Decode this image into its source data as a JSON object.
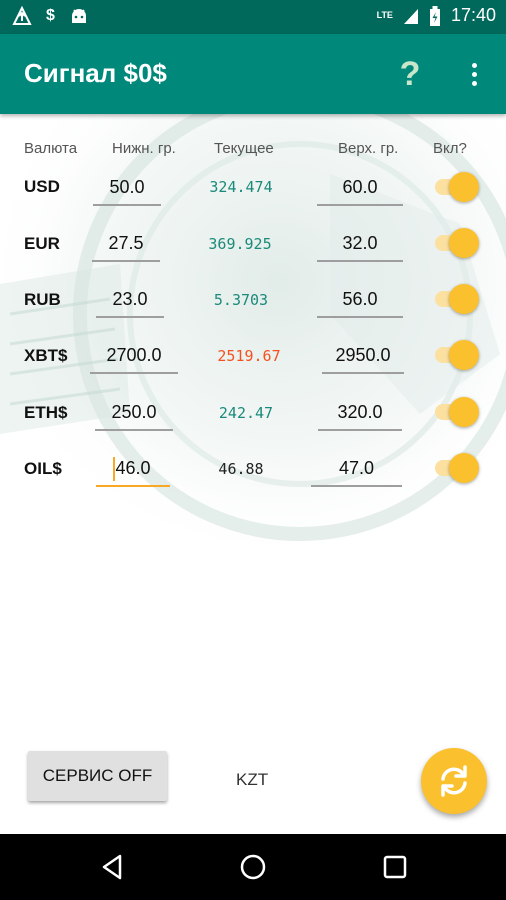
{
  "status_bar": {
    "dollar_icon_text": "$",
    "network_label": "LTE",
    "time": "17:40"
  },
  "app_bar": {
    "title": "Сигнал $0$",
    "help_label": "?"
  },
  "table": {
    "headers": [
      "Валюта",
      "Нижн. гр.",
      "Текущее",
      "Верх. гр.",
      "Вкл?"
    ],
    "rows": [
      {
        "currency": "USD",
        "lower": "50.0",
        "current": "324.474",
        "current_color": "#1b8a7a",
        "upper": "60.0",
        "enabled": true
      },
      {
        "currency": "EUR",
        "lower": "27.5",
        "current": "369.925",
        "current_color": "#1b8a7a",
        "upper": "32.0",
        "enabled": true
      },
      {
        "currency": "RUB",
        "lower": "23.0",
        "current": "5.3703",
        "current_color": "#1b8a7a",
        "upper": "56.0",
        "enabled": true
      },
      {
        "currency": "XBT$",
        "lower": "2700.0",
        "current": "2519.67",
        "current_color": "#f4511e",
        "upper": "2950.0",
        "enabled": true
      },
      {
        "currency": "ETH$",
        "lower": "250.0",
        "current": "242.47",
        "current_color": "#1b8a7a",
        "upper": "320.0",
        "enabled": true
      },
      {
        "currency": "OIL$",
        "lower": "46.0",
        "current": "46.88",
        "current_color": "#222222",
        "upper": "47.0",
        "enabled": true
      }
    ]
  },
  "bottom": {
    "service_button": "СЕРВИС OFF",
    "currency_label": "KZT",
    "refresh_icon": "refresh-icon"
  },
  "colors": {
    "primary": "#00897b",
    "primary_dark": "#00695c",
    "accent": "#fbc02d"
  }
}
